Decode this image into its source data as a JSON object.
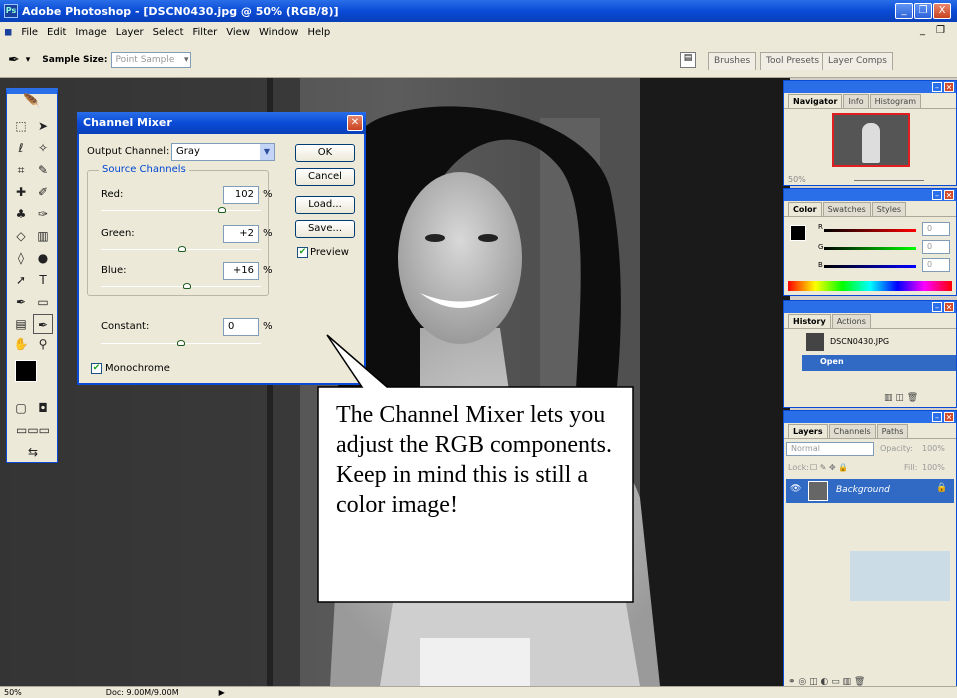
{
  "window": {
    "title": "Adobe Photoshop - [DSCN0430.jpg @ 50% (RGB/8)]",
    "min": "_",
    "max": "❐",
    "close": "X",
    "doc_min": "_",
    "doc_max": "❐"
  },
  "menu": [
    "File",
    "Edit",
    "Image",
    "Layer",
    "Select",
    "Filter",
    "View",
    "Window",
    "Help"
  ],
  "options": {
    "sample_label": "Sample Size:",
    "sample_value": "Point Sample"
  },
  "palette_well": [
    "Brushes",
    "Tool Presets",
    "Layer Comps"
  ],
  "dialog": {
    "title": "Channel Mixer",
    "output_label": "Output Channel:",
    "output_value": "Gray",
    "group_label": "Source Channels",
    "channels": [
      {
        "label": "Red:",
        "value": "102",
        "unit": "%",
        "level": 0.755
      },
      {
        "label": "Green:",
        "value": "+2",
        "unit": "%",
        "level": 0.505
      },
      {
        "label": "Blue:",
        "value": "+16",
        "unit": "%",
        "level": 0.54
      }
    ],
    "constant": {
      "label": "Constant:",
      "value": "0",
      "unit": "%",
      "level": 0.5
    },
    "monochrome_label": "Monochrome",
    "preview_label": "Preview",
    "buttons": {
      "ok": "OK",
      "cancel": "Cancel",
      "load": "Load...",
      "save": "Save..."
    }
  },
  "callout": {
    "text": "The Channel Mixer lets you adjust the RGB components. Keep in mind this is still a color image!"
  },
  "navigator": {
    "tabs": [
      "Navigator",
      "Info",
      "Histogram"
    ],
    "zoom": "50%"
  },
  "color": {
    "tabs": [
      "Color",
      "Swatches",
      "Styles"
    ],
    "channels": [
      {
        "label": "R",
        "value": "0"
      },
      {
        "label": "G",
        "value": "0"
      },
      {
        "label": "B",
        "value": "0"
      }
    ]
  },
  "history": {
    "tabs": [
      "History",
      "Actions"
    ],
    "snapshot": "DSCN0430.JPG",
    "step": "Open"
  },
  "layers": {
    "tabs": [
      "Layers",
      "Channels",
      "Paths"
    ],
    "blend": "Normal",
    "opacity_label": "Opacity:",
    "opacity": "100%",
    "lock_label": "Lock:",
    "fill_label": "Fill:",
    "fill": "100%",
    "layer_name": "Background"
  },
  "status": {
    "zoom": "50%",
    "doc": "Doc: 9.00M/9.00M"
  },
  "colors": {
    "title_blue": "#0a4bd6",
    "history_selected": "#316ac5"
  }
}
